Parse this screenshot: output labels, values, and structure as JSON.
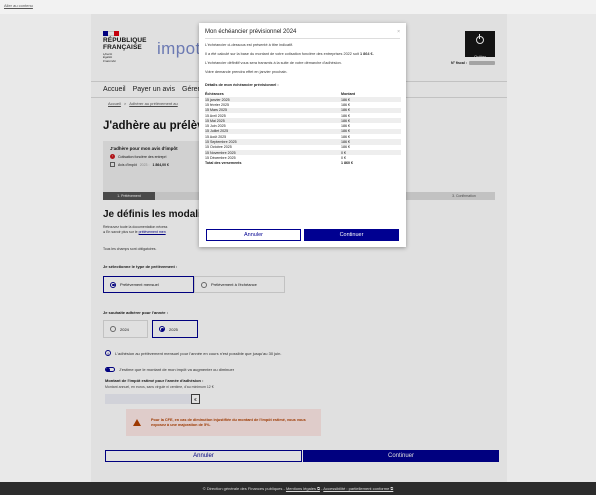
{
  "skip_link": "Aller au contenu",
  "header": {
    "republic": [
      "RÉPUBLIQUE",
      "FRANÇAISE"
    ],
    "motto": [
      "Liberté",
      "Égalité",
      "Fraternité"
    ],
    "brand": "impots",
    "quit_label": "Quitter",
    "fiscal_label": "N° fiscal :"
  },
  "nav": {
    "items": [
      "Accueil",
      "Payer un avis",
      "Gérer un"
    ]
  },
  "breadcrumb": [
    "Accueil",
    ">",
    "Adhérer au prélèvement au"
  ],
  "main": {
    "title": "J'adhère au prélèvemer",
    "info_box": {
      "title": "J'adhère pour mon avis d'impôt",
      "row1": "Cotisation foncière des entrepri",
      "row2_prefix": "Avis d'impôt",
      "row2_year": "2023 :",
      "row2_amount": "1 864,00 €"
    },
    "steps": {
      "s1": "1. Prélèvement",
      "s4": "3. Confirmation"
    },
    "section_title": "Je définis les modalités",
    "doc_line1": "Retrouvez toute la documentation nécess",
    "doc_line2_prefix": "● En savoir plus sur le",
    "doc_link": "prélèvement men",
    "required_note": "Tous les champs sont obligatoires.",
    "payment_type_label": "Je sélectionne le type de prélèvement :",
    "payment_options": [
      "Prélèvement mensuel",
      "Prélèvement à l'échéance"
    ],
    "year_label": "Je souhaite adhérer pour l'année :",
    "year_options": [
      "2024",
      "2025"
    ],
    "notice": "L'adhésion au prélèvement mensuel pour l'année en cours n'est possible que jusqu'au 30 juin.",
    "toggle_label": "J'estime que le montant de mon impôt va augmenter ou diminuer",
    "amount_label": "Montant de l'impôt estimé pour l'année d'adhésion :",
    "amount_hint": "Montant annuel, en euros, sans virgule ni centime, d'au minimum 12 €",
    "amount_value": "",
    "currency": "€",
    "alert": "Pour la CFE, en cas de diminution injustifiée du montant de l'impôt estimé, vous vous exposez à une majoration de 5%.",
    "cancel": "Annuler",
    "continue": "Continuer"
  },
  "footer": {
    "text": "© Direction générale des Finances publiques -",
    "link1": "Mentions légales ⧉",
    "sep": "-",
    "link2": "Accessibilité : partiellement conforme ⧉"
  },
  "modal": {
    "title": "Mon échéancier prévisionnel 2024",
    "close": "×",
    "p1": "L'échéancier ci-dessous est présenté à titre indicatif.",
    "p2_a": "Il a été calculé sur la base du montant de votre cotisation foncière des entreprises 2022 soit",
    "p2_b": "1 864 €.",
    "p3": "L'échéancier définitif vous sera transmis à la suite de votre démarche d'adhésion.",
    "p4": "Votre demande prendra effet en janvier prochain.",
    "details_title": "Détails de mon échéancier prévisionnel :",
    "col_date": "Échéances",
    "col_amount": "Montant",
    "rows": [
      {
        "date": "15 janvier 2025",
        "amount": "186 €"
      },
      {
        "date": "15 février 2025",
        "amount": "186 €"
      },
      {
        "date": "15 Mars 2025",
        "amount": "186 €"
      },
      {
        "date": "15 Avril 2025",
        "amount": "186 €"
      },
      {
        "date": "15 Mai 2025",
        "amount": "186 €"
      },
      {
        "date": "15 Juin 2025",
        "amount": "186 €"
      },
      {
        "date": "15 Juillet 2025",
        "amount": "186 €"
      },
      {
        "date": "15 Août 2025",
        "amount": "186 €"
      },
      {
        "date": "15 Septembre 2025",
        "amount": "186 €"
      },
      {
        "date": "15 Octobre 2025",
        "amount": "186 €"
      },
      {
        "date": "15 Novembre 2025",
        "amount": "0 €"
      },
      {
        "date": "15 Décembre 2025",
        "amount": "0 €"
      }
    ],
    "total_label": "Total des versements",
    "total_value": "1 860 €",
    "cancel": "Annuler",
    "continue": "Continuer"
  },
  "colors": {
    "primary": "#000091",
    "flag_blue": "#000091",
    "flag_white": "#ffffff",
    "flag_red": "#e1000f",
    "alert_bg": "#fee9e6",
    "alert_text": "#b34000"
  }
}
